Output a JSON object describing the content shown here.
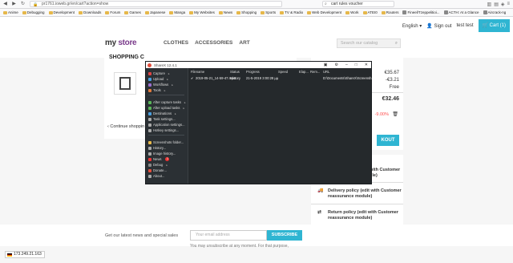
{
  "browser": {
    "url": "pr1761.ioweb.gr/en/cart?action=show",
    "search_value": "cart rules voucher",
    "bookmarks": [
      {
        "label": "Anime",
        "kind": "folder"
      },
      {
        "label": "Debugging",
        "kind": "folder"
      },
      {
        "label": "Development",
        "kind": "folder"
      },
      {
        "label": "Downloads",
        "kind": "folder"
      },
      {
        "label": "Forum",
        "kind": "folder"
      },
      {
        "label": "Games",
        "kind": "folder"
      },
      {
        "label": "Japanese",
        "kind": "folder"
      },
      {
        "label": "Manga",
        "kind": "folder"
      },
      {
        "label": "My Websites",
        "kind": "folder"
      },
      {
        "label": "News",
        "kind": "folder"
      },
      {
        "label": "Shopping",
        "kind": "folder"
      },
      {
        "label": "Sports",
        "kind": "folder"
      },
      {
        "label": "TV & Radio",
        "kind": "folder"
      },
      {
        "label": "Web Development",
        "kind": "folder"
      },
      {
        "label": "Work",
        "kind": "folder"
      },
      {
        "label": "ATEI0",
        "kind": "folder"
      },
      {
        "label": "Routers",
        "kind": "folder"
      },
      {
        "label": "Fineel/Tzeppelitioi...",
        "kind": "site"
      },
      {
        "label": "ACTH: At a Glance",
        "kind": "site"
      },
      {
        "label": "Aircrack-ng",
        "kind": "site"
      }
    ]
  },
  "shop": {
    "logo_my": "my",
    "logo_store": " store",
    "language": "English",
    "sign_out": "Sign out",
    "user": "test test",
    "cart_label": "Cart (1)",
    "nav": [
      "CLOTHES",
      "ACCESSORIES",
      "ART"
    ],
    "search_placeholder": "Search our catalog",
    "cart_title": "SHOPPING C",
    "continue_label": "Continue shoppin",
    "summary": {
      "subtotal": "€35.67",
      "discount_value": "-€3.21",
      "shipping": "Free",
      "total": "€32.46",
      "discount_pct": "-9.00%",
      "link_fragment": "de1",
      "checkout_label": "KOUT"
    },
    "reassurance": {
      "security": "with Customer\nule)",
      "delivery": "Delivery policy (edit with Customer reassurance module)",
      "return": "Return policy (edit with Customer reassurance module)"
    },
    "newsletter": {
      "label": "Get our latest news and special sales",
      "placeholder": "Your email address",
      "button": "SUBSCRIBE",
      "note": "You may unsubscribe at any moment. For that purpose,"
    },
    "ip": "173.249.21.163"
  },
  "sharex": {
    "title": "ShareX 12.4.1",
    "menu": [
      {
        "label": "Capture",
        "has_sub": true,
        "color": "#d44"
      },
      {
        "label": "Upload",
        "has_sub": true,
        "color": "#4a9fe0"
      },
      {
        "label": "Workflows",
        "has_sub": true,
        "color": "#9a6fd0"
      },
      {
        "label": "Tools",
        "has_sub": true,
        "color": "#e07a3c"
      },
      {
        "label": "After capture tasks",
        "has_sub": true,
        "color": "#5ab55a"
      },
      {
        "label": "After upload tasks",
        "has_sub": true,
        "color": "#5ab55a"
      },
      {
        "label": "Destinations",
        "has_sub": true,
        "color": "#4a9fe0"
      },
      {
        "label": "Task settings...",
        "has_sub": false,
        "color": "#aaa"
      },
      {
        "label": "Application settings...",
        "has_sub": false,
        "color": "#aaa"
      },
      {
        "label": "Hotkey settings...",
        "has_sub": false,
        "color": "#aaa"
      },
      {
        "label": "Screenshots folder...",
        "has_sub": false,
        "color": "#e6b84a"
      },
      {
        "label": "History...",
        "has_sub": false,
        "color": "#aaa"
      },
      {
        "label": "Image history...",
        "has_sub": false,
        "color": "#aaa"
      },
      {
        "label": "News",
        "has_sub": false,
        "color": "#e33",
        "badge": "1"
      },
      {
        "label": "Debug",
        "has_sub": true,
        "color": "#888"
      },
      {
        "label": "Donate...",
        "has_sub": false,
        "color": "#e14e3c"
      },
      {
        "label": "About...",
        "has_sub": false,
        "color": "#aaa"
      }
    ],
    "columns": [
      "Filename",
      "Status",
      "Progress",
      "Speed",
      "Elap...",
      "Rem...",
      "URL"
    ],
    "row": {
      "filename": "2019-05-21_14-59-47.mp4",
      "status": "History",
      "progress": "21-5-2019 3:00:28 µµ",
      "url": "D:\\Documents\\ShareX\\Screensh..."
    }
  }
}
